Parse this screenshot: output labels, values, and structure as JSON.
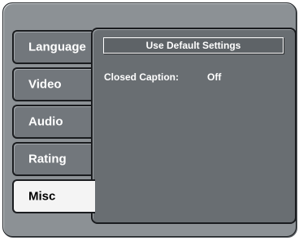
{
  "tabs": [
    {
      "label": "Language",
      "selected": false
    },
    {
      "label": "Video",
      "selected": false
    },
    {
      "label": "Audio",
      "selected": false
    },
    {
      "label": "Rating",
      "selected": false
    },
    {
      "label": "Misc",
      "selected": true
    }
  ],
  "panel": {
    "default_button": "Use Default Settings",
    "settings": [
      {
        "label": "Closed Caption:",
        "value": "Off"
      }
    ]
  },
  "colors": {
    "frame_bg": "#8c9195",
    "panel_bg": "#696e72",
    "tab_bg": "#72777c",
    "tab_selected_bg": "#f4f4f4",
    "text": "#ffffff"
  }
}
